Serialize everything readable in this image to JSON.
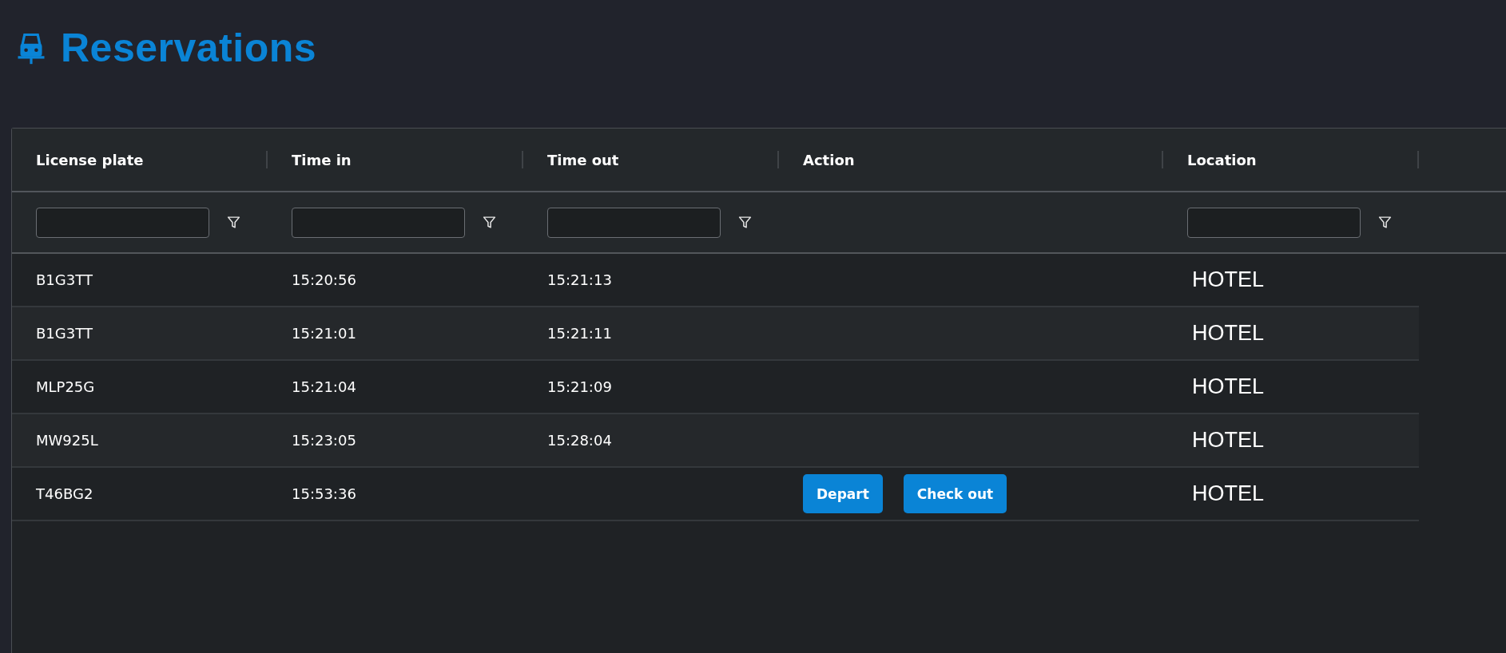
{
  "page": {
    "title": "Reservations"
  },
  "table": {
    "columns": [
      {
        "label": "License plate",
        "filter": true
      },
      {
        "label": "Time in",
        "filter": true
      },
      {
        "label": "Time out",
        "filter": true
      },
      {
        "label": "Action",
        "filter": false
      },
      {
        "label": "Location",
        "filter": true
      }
    ],
    "rows": [
      {
        "license_plate": "B1G3TT",
        "time_in": "15:20:56",
        "time_out": "15:21:13",
        "actions": [],
        "location": "HOTEL"
      },
      {
        "license_plate": "B1G3TT",
        "time_in": "15:21:01",
        "time_out": "15:21:11",
        "actions": [],
        "location": "HOTEL"
      },
      {
        "license_plate": "MLP25G",
        "time_in": "15:21:04",
        "time_out": "15:21:09",
        "actions": [],
        "location": "HOTEL"
      },
      {
        "license_plate": "MW925L",
        "time_in": "15:23:05",
        "time_out": "15:28:04",
        "actions": [],
        "location": "HOTEL"
      },
      {
        "license_plate": "T46BG2",
        "time_in": "15:53:36",
        "actions": [
          "Depart",
          "Check out"
        ],
        "location": "HOTEL"
      }
    ]
  }
}
